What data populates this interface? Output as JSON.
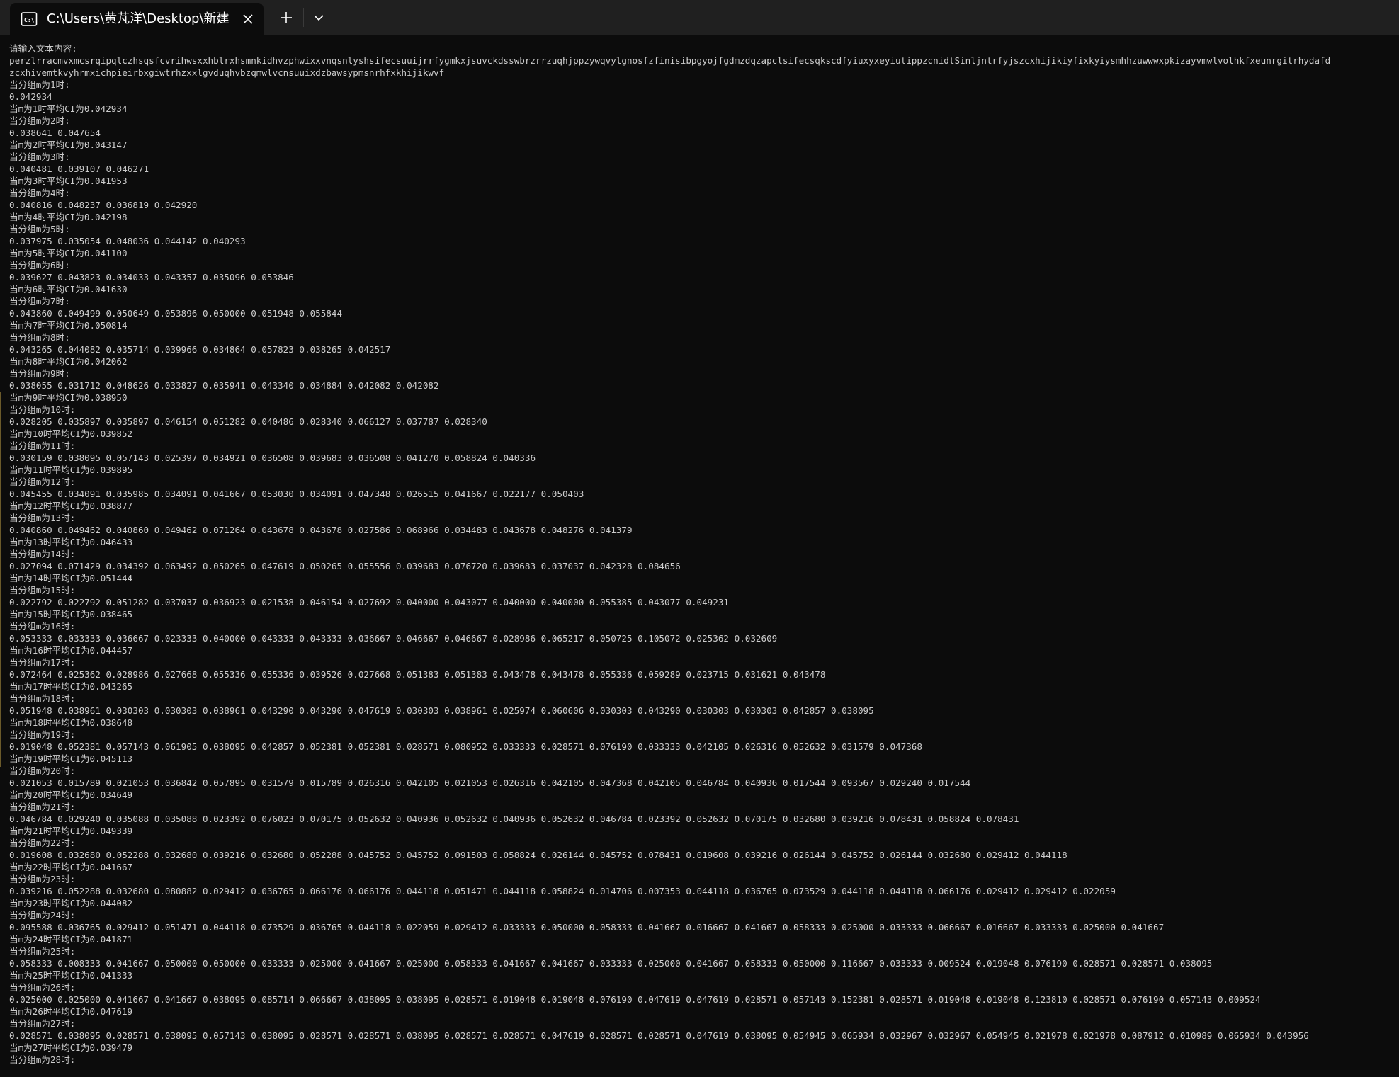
{
  "tab": {
    "title": "C:\\Users\\黄芃洋\\Desktop\\新建",
    "icon": "console-icon"
  },
  "terminal": {
    "lines": [
      "请输入文本内容:",
      "perzlrracmvxmcsrqipqlczhsqsfcvrihwsxxhblrxhsmnkidhvzphwixxvnqsnlyshsifecsuuijrrfygmkxjsuvckdsswbrzrrzuqhjppzywqvylgnosfzfinisibpgyojfgdmzdqzapclsifecsqkscdfyiuxyxeyiutippzcnidtSinljntrfyjszcxhijikiyfixkyiysmhhzuwwwxpkizayvmwlvolhkfxeunrgitrhydafd",
      "zcxhivemtkvyhrmxichpieirbxgiwtrhzxxlgvduqhvbzqmwlvcnsuuixdzbawsypmsnrhfxkhijikwvf",
      "当分组m为1时:",
      "0.042934",
      "当m为1时平均CI为0.042934",
      "当分组m为2时:",
      "0.038641 0.047654",
      "当m为2时平均CI为0.043147",
      "当分组m为3时:",
      "0.040481 0.039107 0.046271",
      "当m为3时平均CI为0.041953",
      "当分组m为4时:",
      "0.040816 0.048237 0.036819 0.042920",
      "当m为4时平均CI为0.042198",
      "当分组m为5时:",
      "0.037975 0.035054 0.048036 0.044142 0.040293",
      "当m为5时平均CI为0.041100",
      "当分组m为6时:",
      "0.039627 0.043823 0.034033 0.043357 0.035096 0.053846",
      "当m为6时平均CI为0.041630",
      "当分组m为7时:",
      "0.043860 0.049499 0.050649 0.053896 0.050000 0.051948 0.055844",
      "当m为7时平均CI为0.050814",
      "当分组m为8时:",
      "0.043265 0.044082 0.035714 0.039966 0.034864 0.057823 0.038265 0.042517",
      "当m为8时平均CI为0.042062",
      "当分组m为9时:",
      "0.038055 0.031712 0.048626 0.033827 0.035941 0.043340 0.034884 0.042082 0.042082",
      "当m为9时平均CI为0.038950",
      "当分组m为10时:",
      "0.028205 0.035897 0.035897 0.046154 0.051282 0.040486 0.028340 0.066127 0.037787 0.028340",
      "当m为10时平均CI为0.039852",
      "当分组m为11时:",
      "0.030159 0.038095 0.057143 0.025397 0.034921 0.036508 0.039683 0.036508 0.041270 0.058824 0.040336",
      "当m为11时平均CI为0.039895",
      "当分组m为12时:",
      "0.045455 0.034091 0.035985 0.034091 0.041667 0.053030 0.034091 0.047348 0.026515 0.041667 0.022177 0.050403",
      "当m为12时平均CI为0.038877",
      "当分组m为13时:",
      "0.040860 0.049462 0.040860 0.049462 0.071264 0.043678 0.043678 0.027586 0.068966 0.034483 0.043678 0.048276 0.041379",
      "当m为13时平均CI为0.046433",
      "当分组m为14时:",
      "0.027094 0.071429 0.034392 0.063492 0.050265 0.047619 0.050265 0.055556 0.039683 0.076720 0.039683 0.037037 0.042328 0.084656",
      "当m为14时平均CI为0.051444",
      "当分组m为15时:",
      "0.022792 0.022792 0.051282 0.037037 0.036923 0.021538 0.046154 0.027692 0.040000 0.043077 0.040000 0.040000 0.055385 0.043077 0.049231",
      "当m为15时平均CI为0.038465",
      "当分组m为16时:",
      "0.053333 0.033333 0.036667 0.023333 0.040000 0.043333 0.043333 0.036667 0.046667 0.046667 0.028986 0.065217 0.050725 0.105072 0.025362 0.032609",
      "当m为16时平均CI为0.044457",
      "当分组m为17时:",
      "0.072464 0.025362 0.028986 0.027668 0.055336 0.055336 0.039526 0.027668 0.051383 0.051383 0.043478 0.043478 0.055336 0.059289 0.023715 0.031621 0.043478",
      "当m为17时平均CI为0.043265",
      "当分组m为18时:",
      "0.051948 0.038961 0.030303 0.030303 0.038961 0.043290 0.043290 0.047619 0.030303 0.038961 0.025974 0.060606 0.030303 0.043290 0.030303 0.030303 0.042857 0.038095",
      "当m为18时平均CI为0.038648",
      "当分组m为19时:",
      "0.019048 0.052381 0.057143 0.061905 0.038095 0.042857 0.052381 0.052381 0.028571 0.080952 0.033333 0.028571 0.076190 0.033333 0.042105 0.026316 0.052632 0.031579 0.047368",
      "当m为19时平均CI为0.045113",
      "当分组m为20时:",
      "0.021053 0.015789 0.021053 0.036842 0.057895 0.031579 0.015789 0.026316 0.042105 0.021053 0.026316 0.042105 0.047368 0.042105 0.046784 0.040936 0.017544 0.093567 0.029240 0.017544",
      "当m为20时平均CI为0.034649",
      "当分组m为21时:",
      "0.046784 0.029240 0.035088 0.035088 0.023392 0.076023 0.070175 0.052632 0.040936 0.052632 0.040936 0.052632 0.046784 0.023392 0.052632 0.070175 0.032680 0.039216 0.078431 0.058824 0.078431",
      "当m为21时平均CI为0.049339",
      "当分组m为22时:",
      "0.019608 0.032680 0.052288 0.032680 0.039216 0.032680 0.052288 0.045752 0.045752 0.091503 0.058824 0.026144 0.045752 0.078431 0.019608 0.039216 0.026144 0.045752 0.026144 0.032680 0.029412 0.044118",
      "当m为22时平均CI为0.041667",
      "当分组m为23时:",
      "0.039216 0.052288 0.032680 0.080882 0.029412 0.036765 0.066176 0.066176 0.044118 0.051471 0.044118 0.058824 0.014706 0.007353 0.044118 0.036765 0.073529 0.044118 0.044118 0.066176 0.029412 0.029412 0.022059",
      "当m为23时平均CI为0.044082",
      "当分组m为24时:",
      "0.095588 0.036765 0.029412 0.051471 0.044118 0.073529 0.036765 0.044118 0.022059 0.029412 0.033333 0.050000 0.058333 0.041667 0.016667 0.041667 0.058333 0.025000 0.033333 0.066667 0.016667 0.033333 0.025000 0.041667",
      "当m为24时平均CI为0.041871",
      "当分组m为25时:",
      "0.058333 0.008333 0.041667 0.050000 0.050000 0.033333 0.025000 0.041667 0.025000 0.058333 0.041667 0.041667 0.033333 0.025000 0.041667 0.058333 0.050000 0.116667 0.033333 0.009524 0.019048 0.076190 0.028571 0.028571 0.038095",
      "当m为25时平均CI为0.041333",
      "当分组m为26时:",
      "0.025000 0.025000 0.041667 0.041667 0.038095 0.085714 0.066667 0.038095 0.038095 0.028571 0.019048 0.019048 0.076190 0.047619 0.047619 0.028571 0.057143 0.152381 0.028571 0.019048 0.019048 0.123810 0.028571 0.076190 0.057143 0.009524",
      "当m为26时平均CI为0.047619",
      "当分组m为27时:",
      "0.028571 0.038095 0.028571 0.038095 0.057143 0.038095 0.028571 0.028571 0.038095 0.028571 0.028571 0.047619 0.028571 0.028571 0.047619 0.038095 0.054945 0.065934 0.032967 0.032967 0.054945 0.021978 0.021978 0.087912 0.010989 0.065934 0.043956",
      "当m为27时平均CI为0.039479",
      "当分组m为28时:"
    ]
  }
}
